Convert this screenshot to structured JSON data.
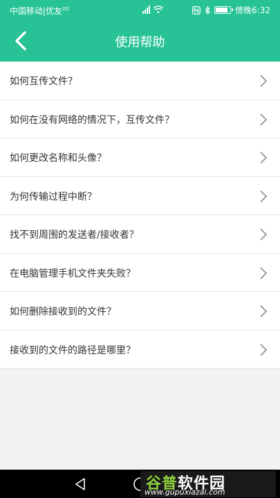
{
  "status": {
    "carrier": "中国移动|优友",
    "network": "2G",
    "time": "傍晚6:32"
  },
  "header": {
    "title": "使用帮助"
  },
  "help_items": [
    "如何互传文件？",
    "如何在没有网络的情况下，互传文件？",
    "如何更改名称和头像？",
    "为何传输过程中断？",
    "找不到周围的发送者/接收者？",
    "在电脑管理手机文件夹失败？",
    "如何删除接收到的文件？",
    "接收到的文件的路径是哪里？"
  ],
  "watermark": {
    "part1": "谷普",
    "part2": "软件园",
    "url": "www.gupuxiazai.com"
  },
  "colors": {
    "accent": "#27c396"
  }
}
